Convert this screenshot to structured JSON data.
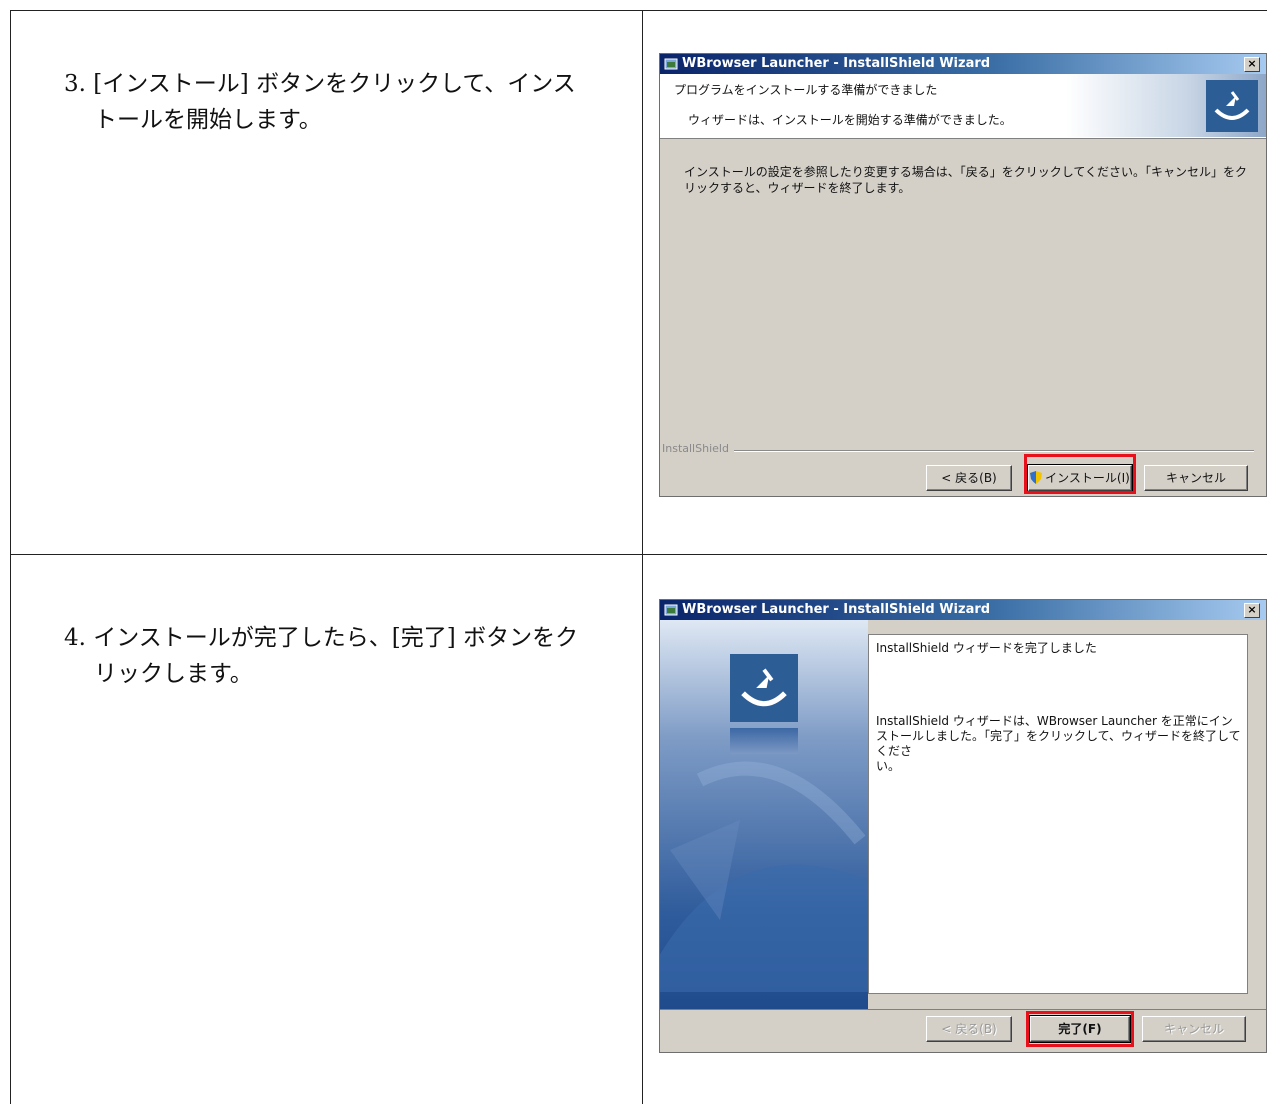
{
  "steps": [
    {
      "number": "3.",
      "line1": "[インストール] ボタンをクリックして、インス",
      "line2": "トールを開始します。"
    },
    {
      "number": "4.",
      "line1": "インストールが完了したら、[完了] ボタンをク",
      "line2": "リックします。"
    }
  ],
  "dialog_install": {
    "title": "WBrowser Launcher - InstallShield Wizard",
    "close_label": "×",
    "header_title": "プログラムをインストールする準備ができました",
    "header_subtitle": "ウィザードは、インストールを開始する準備ができました。",
    "body_line1": "インストールの設定を参照したり変更する場合は、「戻る」をクリックしてください。「キャンセル」をク",
    "body_line2": "リックすると、ウィザードを終了します。",
    "brand_label": "InstallShield",
    "back_button": "< 戻る(B)",
    "install_button": "インストール(I)",
    "cancel_button": "キャンセル"
  },
  "dialog_finish": {
    "title": "WBrowser Launcher - InstallShield Wizard",
    "close_label": "×",
    "heading": "InstallShield ウィザードを完了しました",
    "body_line1": "InstallShield ウィザードは、WBrowser Launcher を正常にイン",
    "body_line2": "ストールしました。「完了」をクリックして、ウィザードを終了してくださ",
    "body_line3": "い。",
    "back_button": "< 戻る(B)",
    "finish_button": "完了(F)",
    "cancel_button": "キャンセル"
  },
  "colors": {
    "highlight": "#e8101a",
    "titlebar": "#0a246a",
    "dialog_face": "#d4d0c8",
    "logo_blue": "#2c5d95"
  }
}
